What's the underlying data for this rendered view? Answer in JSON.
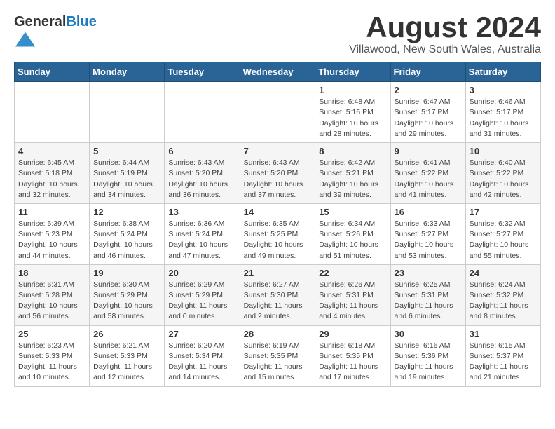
{
  "header": {
    "logo_general": "General",
    "logo_blue": "Blue",
    "month_title": "August 2024",
    "location": "Villawood, New South Wales, Australia"
  },
  "calendar": {
    "days_of_week": [
      "Sunday",
      "Monday",
      "Tuesday",
      "Wednesday",
      "Thursday",
      "Friday",
      "Saturday"
    ],
    "weeks": [
      [
        {
          "day": "",
          "info": ""
        },
        {
          "day": "",
          "info": ""
        },
        {
          "day": "",
          "info": ""
        },
        {
          "day": "",
          "info": ""
        },
        {
          "day": "1",
          "info": "Sunrise: 6:48 AM\nSunset: 5:16 PM\nDaylight: 10 hours\nand 28 minutes."
        },
        {
          "day": "2",
          "info": "Sunrise: 6:47 AM\nSunset: 5:17 PM\nDaylight: 10 hours\nand 29 minutes."
        },
        {
          "day": "3",
          "info": "Sunrise: 6:46 AM\nSunset: 5:17 PM\nDaylight: 10 hours\nand 31 minutes."
        }
      ],
      [
        {
          "day": "4",
          "info": "Sunrise: 6:45 AM\nSunset: 5:18 PM\nDaylight: 10 hours\nand 32 minutes."
        },
        {
          "day": "5",
          "info": "Sunrise: 6:44 AM\nSunset: 5:19 PM\nDaylight: 10 hours\nand 34 minutes."
        },
        {
          "day": "6",
          "info": "Sunrise: 6:43 AM\nSunset: 5:20 PM\nDaylight: 10 hours\nand 36 minutes."
        },
        {
          "day": "7",
          "info": "Sunrise: 6:43 AM\nSunset: 5:20 PM\nDaylight: 10 hours\nand 37 minutes."
        },
        {
          "day": "8",
          "info": "Sunrise: 6:42 AM\nSunset: 5:21 PM\nDaylight: 10 hours\nand 39 minutes."
        },
        {
          "day": "9",
          "info": "Sunrise: 6:41 AM\nSunset: 5:22 PM\nDaylight: 10 hours\nand 41 minutes."
        },
        {
          "day": "10",
          "info": "Sunrise: 6:40 AM\nSunset: 5:22 PM\nDaylight: 10 hours\nand 42 minutes."
        }
      ],
      [
        {
          "day": "11",
          "info": "Sunrise: 6:39 AM\nSunset: 5:23 PM\nDaylight: 10 hours\nand 44 minutes."
        },
        {
          "day": "12",
          "info": "Sunrise: 6:38 AM\nSunset: 5:24 PM\nDaylight: 10 hours\nand 46 minutes."
        },
        {
          "day": "13",
          "info": "Sunrise: 6:36 AM\nSunset: 5:24 PM\nDaylight: 10 hours\nand 47 minutes."
        },
        {
          "day": "14",
          "info": "Sunrise: 6:35 AM\nSunset: 5:25 PM\nDaylight: 10 hours\nand 49 minutes."
        },
        {
          "day": "15",
          "info": "Sunrise: 6:34 AM\nSunset: 5:26 PM\nDaylight: 10 hours\nand 51 minutes."
        },
        {
          "day": "16",
          "info": "Sunrise: 6:33 AM\nSunset: 5:27 PM\nDaylight: 10 hours\nand 53 minutes."
        },
        {
          "day": "17",
          "info": "Sunrise: 6:32 AM\nSunset: 5:27 PM\nDaylight: 10 hours\nand 55 minutes."
        }
      ],
      [
        {
          "day": "18",
          "info": "Sunrise: 6:31 AM\nSunset: 5:28 PM\nDaylight: 10 hours\nand 56 minutes."
        },
        {
          "day": "19",
          "info": "Sunrise: 6:30 AM\nSunset: 5:29 PM\nDaylight: 10 hours\nand 58 minutes."
        },
        {
          "day": "20",
          "info": "Sunrise: 6:29 AM\nSunset: 5:29 PM\nDaylight: 11 hours\nand 0 minutes."
        },
        {
          "day": "21",
          "info": "Sunrise: 6:27 AM\nSunset: 5:30 PM\nDaylight: 11 hours\nand 2 minutes."
        },
        {
          "day": "22",
          "info": "Sunrise: 6:26 AM\nSunset: 5:31 PM\nDaylight: 11 hours\nand 4 minutes."
        },
        {
          "day": "23",
          "info": "Sunrise: 6:25 AM\nSunset: 5:31 PM\nDaylight: 11 hours\nand 6 minutes."
        },
        {
          "day": "24",
          "info": "Sunrise: 6:24 AM\nSunset: 5:32 PM\nDaylight: 11 hours\nand 8 minutes."
        }
      ],
      [
        {
          "day": "25",
          "info": "Sunrise: 6:23 AM\nSunset: 5:33 PM\nDaylight: 11 hours\nand 10 minutes."
        },
        {
          "day": "26",
          "info": "Sunrise: 6:21 AM\nSunset: 5:33 PM\nDaylight: 11 hours\nand 12 minutes."
        },
        {
          "day": "27",
          "info": "Sunrise: 6:20 AM\nSunset: 5:34 PM\nDaylight: 11 hours\nand 14 minutes."
        },
        {
          "day": "28",
          "info": "Sunrise: 6:19 AM\nSunset: 5:35 PM\nDaylight: 11 hours\nand 15 minutes."
        },
        {
          "day": "29",
          "info": "Sunrise: 6:18 AM\nSunset: 5:35 PM\nDaylight: 11 hours\nand 17 minutes."
        },
        {
          "day": "30",
          "info": "Sunrise: 6:16 AM\nSunset: 5:36 PM\nDaylight: 11 hours\nand 19 minutes."
        },
        {
          "day": "31",
          "info": "Sunrise: 6:15 AM\nSunset: 5:37 PM\nDaylight: 11 hours\nand 21 minutes."
        }
      ]
    ]
  }
}
